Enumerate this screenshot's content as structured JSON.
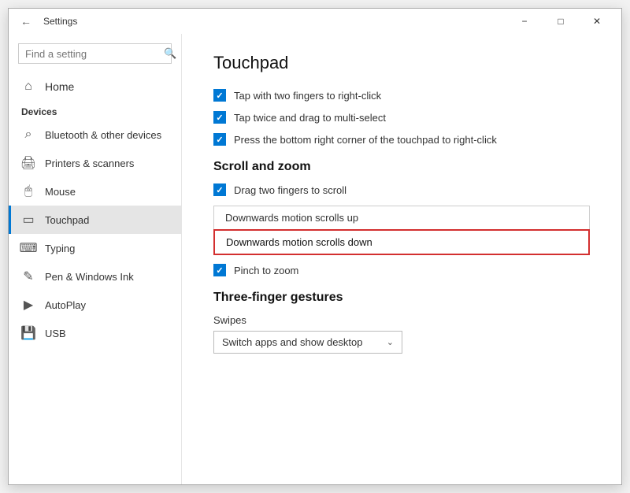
{
  "window": {
    "title": "Settings",
    "min_label": "−",
    "max_label": "□",
    "close_label": "✕"
  },
  "sidebar": {
    "search_placeholder": "Find a setting",
    "home_label": "Home",
    "section_label": "Devices",
    "items": [
      {
        "id": "bluetooth",
        "label": "Bluetooth & other devices",
        "icon": "bluetooth"
      },
      {
        "id": "printers",
        "label": "Printers & scanners",
        "icon": "printer"
      },
      {
        "id": "mouse",
        "label": "Mouse",
        "icon": "mouse"
      },
      {
        "id": "touchpad",
        "label": "Touchpad",
        "icon": "touchpad",
        "active": true
      },
      {
        "id": "typing",
        "label": "Typing",
        "icon": "typing"
      },
      {
        "id": "pen",
        "label": "Pen & Windows Ink",
        "icon": "pen"
      },
      {
        "id": "autoplay",
        "label": "AutoPlay",
        "icon": "autoplay"
      },
      {
        "id": "usb",
        "label": "USB",
        "icon": "usb"
      }
    ]
  },
  "main": {
    "title": "Touchpad",
    "checkboxes": [
      {
        "id": "two-finger-click",
        "label": "Tap with two fingers to right-click",
        "checked": true
      },
      {
        "id": "double-tap",
        "label": "Tap twice and drag to multi-select",
        "checked": true
      },
      {
        "id": "bottom-right",
        "label": "Press the bottom right corner of the touchpad to right-click",
        "checked": true
      }
    ],
    "scroll_zoom_heading": "Scroll and zoom",
    "drag_scroll_label": "Drag two fingers to scroll",
    "drag_scroll_checked": true,
    "scroll_options": [
      {
        "id": "scroll-up",
        "label": "Downwards motion scrolls up",
        "selected": false
      },
      {
        "id": "scroll-down",
        "label": "Downwards motion scrolls down",
        "selected": true
      }
    ],
    "pinch_label": "Pinch to zoom",
    "pinch_checked": true,
    "three_finger_heading": "Three-finger gestures",
    "swipes_label": "Swipes",
    "swipes_value": "Switch apps and show desktop",
    "chevron": "⌄"
  }
}
